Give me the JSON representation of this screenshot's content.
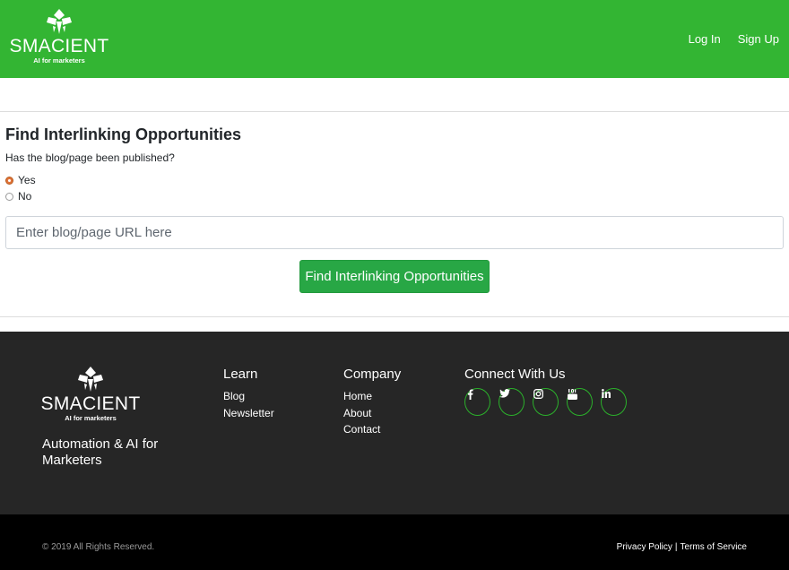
{
  "header": {
    "brand": "SMACIENT",
    "brand_tagline": "AI for marketers",
    "login_label": "Log In",
    "signup_label": "Sign Up"
  },
  "main": {
    "title": "Find Interlinking Opportunities",
    "question": "Has the blog/page been published?",
    "options": [
      {
        "label": "Yes",
        "checked": true
      },
      {
        "label": "No",
        "checked": false
      }
    ],
    "url_placeholder": "Enter blog/page URL here",
    "submit_label": "Find Interlinking Opportunities"
  },
  "footer": {
    "brand": "SMACIENT",
    "brand_tagline": "AI for marketers",
    "tagline": "Automation & AI for Marketers",
    "learn": {
      "heading": "Learn",
      "links": [
        "Blog",
        "Newsletter"
      ]
    },
    "company": {
      "heading": "Company",
      "links": [
        "Home",
        "About",
        "Contact"
      ]
    },
    "connect": {
      "heading": "Connect With Us",
      "icons": [
        "facebook-icon",
        "twitter-icon",
        "instagram-icon",
        "youtube-icon",
        "linkedin-icon"
      ]
    },
    "copyright": "© 2019 All Rights Reserved.",
    "privacy_label": "Privacy Policy",
    "separator": "|",
    "terms_label": "Terms of Service"
  },
  "colors": {
    "brand_green": "#33b533",
    "button_green": "#28a745",
    "footer_bg": "#262626",
    "bottom_bg": "#000000"
  }
}
